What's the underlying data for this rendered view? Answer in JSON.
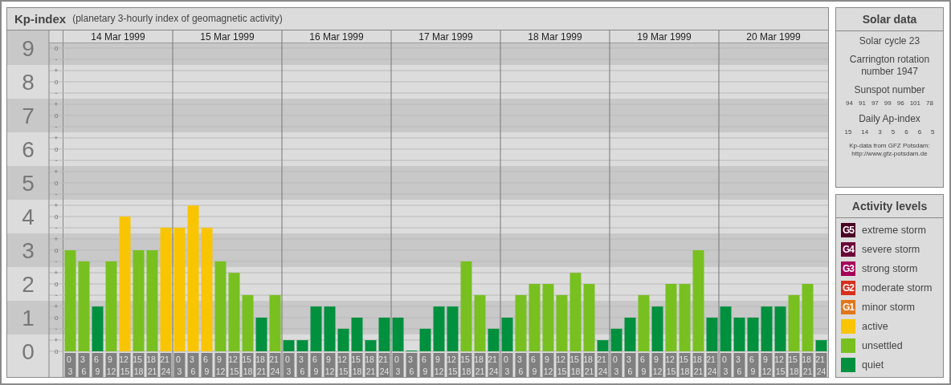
{
  "header": {
    "title": "Kp-index",
    "subtitle": "(planetary 3-hourly index of geomagnetic activity)"
  },
  "kp_chart": {
    "days": [
      {
        "date": "14 Mar 1999"
      },
      {
        "date": "15 Mar 1999"
      },
      {
        "date": "16 Mar 1999"
      },
      {
        "date": "17 Mar 1999"
      },
      {
        "date": "18 Mar 1999"
      },
      {
        "date": "19 Mar 1999"
      },
      {
        "date": "20 Mar 1999"
      }
    ],
    "y_minor_labels": [
      "o",
      "-",
      "+",
      "o",
      "-",
      "+",
      "o",
      "-",
      "+",
      "o",
      "-",
      "+",
      "o",
      "-",
      "+",
      "o",
      "-",
      "+",
      "o",
      "-",
      "+",
      "o",
      "-",
      "+",
      "o",
      "-",
      "+",
      "o"
    ],
    "chart_data": {
      "type": "bar",
      "ylim": [
        0,
        9
      ],
      "grid": true,
      "categories": [
        "0 3",
        "3 6",
        "6 9",
        "9 12",
        "12 15",
        "15 18",
        "18 21",
        "21 24",
        "0 3",
        "3 6",
        "6 9",
        "9 12",
        "12 15",
        "15 18",
        "18 21",
        "21 24",
        "0 3",
        "3 6",
        "6 9",
        "9 12",
        "12 15",
        "15 18",
        "18 21",
        "21 24",
        "0 3",
        "3 6",
        "6 9",
        "9 12",
        "12 15",
        "15 18",
        "18 21",
        "21 24",
        "0 3",
        "3 6",
        "6 9",
        "9 12",
        "12 15",
        "15 18",
        "18 21",
        "21 24",
        "0 3",
        "3 6",
        "6 9",
        "9 12",
        "12 15",
        "15 18",
        "18 21",
        "21 24",
        "0 3",
        "3 6",
        "6 9",
        "9 12",
        "12 15",
        "15 18",
        "18 21",
        "21 24"
      ],
      "yticks": [
        {
          "value": 0,
          "label": "0"
        },
        {
          "value": 1,
          "label": "1"
        },
        {
          "value": 2,
          "label": "2"
        },
        {
          "value": 3,
          "label": "3"
        },
        {
          "value": 4,
          "label": "4"
        },
        {
          "value": 5,
          "label": "5"
        },
        {
          "value": 6,
          "label": "6"
        },
        {
          "value": 7,
          "label": "7"
        },
        {
          "value": 8,
          "label": "8"
        },
        {
          "value": 9,
          "label": "9"
        }
      ],
      "series": [
        {
          "values": [
            3,
            2.67,
            1.33,
            2.67,
            4,
            3,
            3,
            3.67,
            3.67,
            4.33,
            3.67,
            2.67,
            2.33,
            1.67,
            1,
            1.67,
            0.33,
            0.33,
            1.33,
            1.33,
            0.67,
            1,
            0.33,
            1,
            1,
            0,
            0.67,
            1.33,
            1.33,
            2.67,
            1.67,
            0.67,
            1,
            1.67,
            2,
            2,
            1.67,
            2.33,
            2,
            0.33,
            0.67,
            1,
            1.67,
            1.33,
            2,
            2,
            3,
            1,
            1.33,
            1,
            1,
            1.33,
            1.33,
            1.67,
            2,
            0.33
          ]
        }
      ]
    }
  },
  "solar_data": {
    "title": "Solar data",
    "solar_cycle": "Solar cycle 23",
    "carrington": "Carrington rotation number 1947",
    "sunspot_title": "Sunspot number",
    "sunspot_numbers": [
      "94",
      "91",
      "97",
      "99",
      "96",
      "101",
      "78"
    ],
    "ap_title": "Daily Ap-index",
    "ap_values": [
      "15",
      "14",
      "3",
      "5",
      "6",
      "6",
      "5"
    ],
    "credit": [
      "Kp-data from GFZ Potsdam:",
      "http://www.gfz-potsdam.de"
    ]
  },
  "activity_levels": {
    "title": "Activity levels",
    "items": [
      {
        "badge": "G5",
        "label": "extreme storm",
        "color": "#4a0025"
      },
      {
        "badge": "G4",
        "label": "severe storm",
        "color": "#6c0039"
      },
      {
        "badge": "G3",
        "label": "strong storm",
        "color": "#a6005a"
      },
      {
        "badge": "G2",
        "label": "moderate storm",
        "color": "#d7301c"
      },
      {
        "badge": "G1",
        "label": "minor storm",
        "color": "#e3761a"
      },
      {
        "label": "active",
        "color": "#f9c500"
      },
      {
        "label": "unsettled",
        "color": "#78c020"
      },
      {
        "label": "quiet",
        "color": "#00903e"
      }
    ]
  }
}
